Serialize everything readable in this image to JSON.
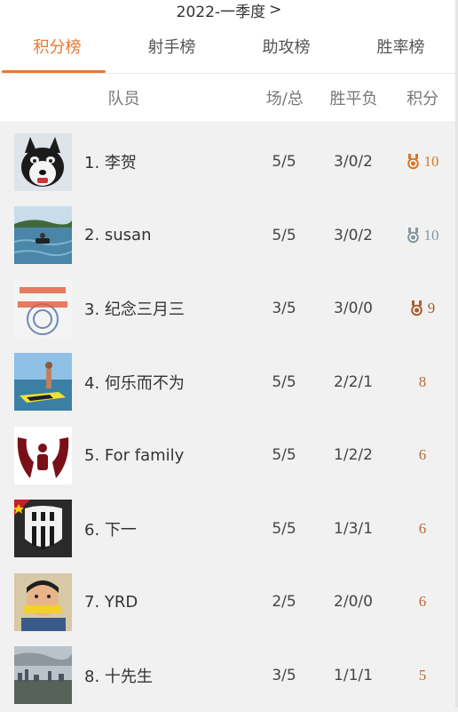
{
  "season": {
    "label": "2022-一季度",
    "chevron": ">"
  },
  "tabs": [
    {
      "label": "积分榜",
      "active": true
    },
    {
      "label": "射手榜",
      "active": false
    },
    {
      "label": "助攻榜",
      "active": false
    },
    {
      "label": "胜率榜",
      "active": false
    }
  ],
  "columns": {
    "player": "队员",
    "games": "场/总",
    "wdl": "胜平负",
    "points": "积分"
  },
  "colors": {
    "accent": "#e5782f",
    "gold": "#d9771f",
    "silver": "#8896a0",
    "bronze": "#a66032",
    "points": "#b96a3a"
  },
  "players": [
    {
      "name": "1. 李贺",
      "games": "5/5",
      "wdl": "3/0/2",
      "points": "10",
      "medal": "gold",
      "avatar_icon": "husky-dog-avatar"
    },
    {
      "name": "2. susan",
      "games": "5/5",
      "wdl": "3/0/2",
      "points": "10",
      "medal": "silver",
      "avatar_icon": "jetski-lake-avatar"
    },
    {
      "name": "3. 纪念三月三",
      "games": "3/5",
      "wdl": "3/0/0",
      "points": "9",
      "medal": "bronze",
      "avatar_icon": "text-collage-avatar"
    },
    {
      "name": "4. 何乐而不为",
      "games": "5/5",
      "wdl": "2/2/1",
      "points": "8",
      "medal": null,
      "avatar_icon": "jetski-beach-avatar"
    },
    {
      "name": "5. For family",
      "games": "5/5",
      "wdl": "1/2/2",
      "points": "6",
      "medal": null,
      "avatar_icon": "family-logo-avatar"
    },
    {
      "name": "6. 下一",
      "games": "5/5",
      "wdl": "1/3/1",
      "points": "6",
      "medal": null,
      "avatar_icon": "juventus-avatar"
    },
    {
      "name": "7. YRD",
      "games": "2/5",
      "wdl": "2/0/0",
      "points": "6",
      "medal": null,
      "avatar_icon": "child-corn-avatar"
    },
    {
      "name": "8. 十先生",
      "games": "3/5",
      "wdl": "1/1/1",
      "points": "5",
      "medal": null,
      "avatar_icon": "city-skyline-avatar"
    }
  ]
}
